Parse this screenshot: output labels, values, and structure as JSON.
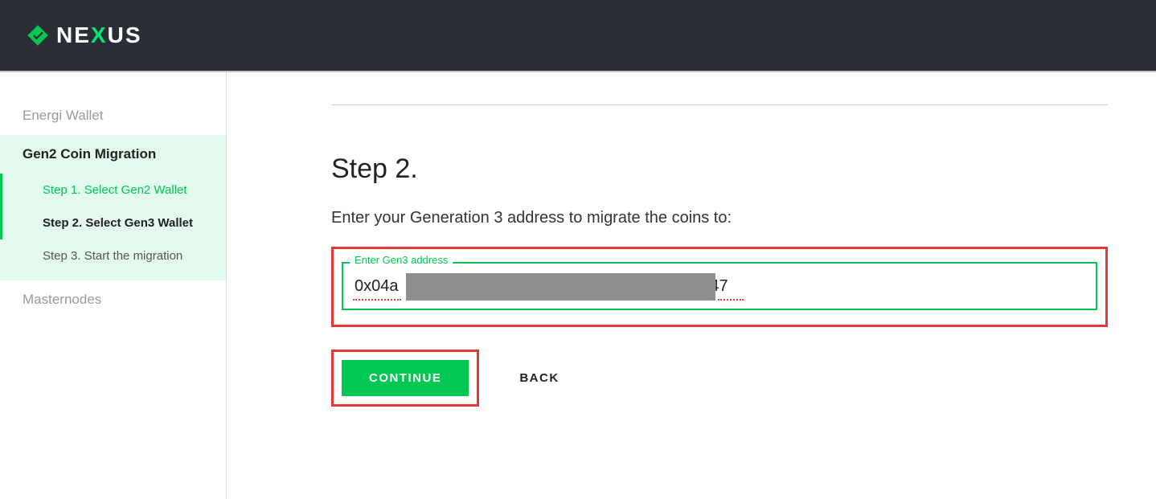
{
  "brand": {
    "name_pre": "NE",
    "name_accent": "X",
    "name_post": "US"
  },
  "sidebar": {
    "items": [
      {
        "label": "Energi Wallet"
      },
      {
        "label": "Gen2 Coin Migration"
      },
      {
        "label": "Masternodes"
      }
    ],
    "steps": [
      {
        "label": "Step 1. Select Gen2 Wallet"
      },
      {
        "label": "Step 2. Select Gen3 Wallet"
      },
      {
        "label": "Step 3. Start the migration"
      }
    ]
  },
  "main": {
    "title": "Step 2.",
    "description": "Enter your Generation 3 address to migrate the coins to:",
    "field_label": "Enter Gen3 address",
    "field_value_prefix": "0x04a",
    "field_value_suffix": "c47",
    "continue_label": "CONTINUE",
    "back_label": "BACK"
  }
}
